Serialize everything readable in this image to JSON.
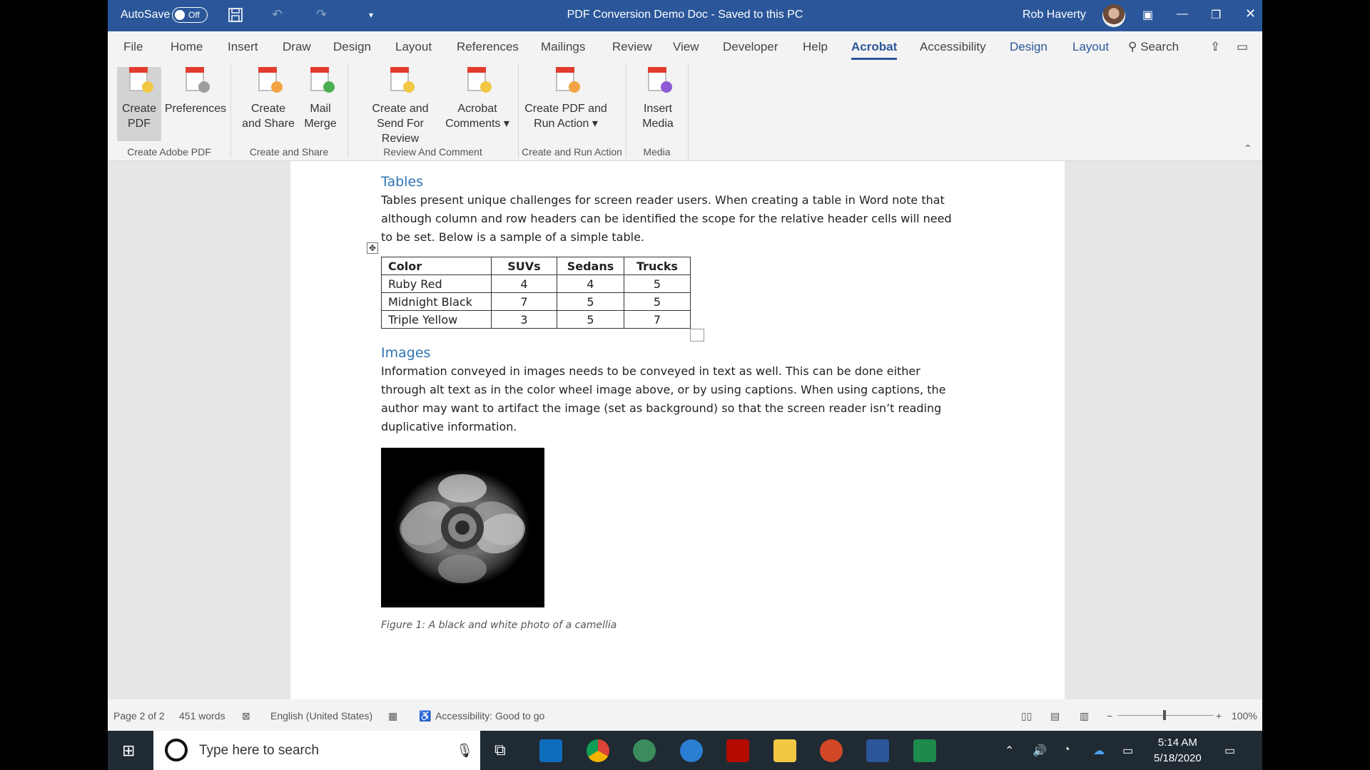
{
  "titlebar": {
    "autosave_label": "AutoSave",
    "autosave_state": "Off",
    "doc_title": "PDF Conversion Demo Doc  -  Saved to this PC",
    "user_name": "Rob Haverty"
  },
  "menu": {
    "tabs": [
      "File",
      "Home",
      "Insert",
      "Draw",
      "Design",
      "Layout",
      "References",
      "Mailings",
      "Review",
      "View",
      "Developer",
      "Help",
      "Acrobat",
      "Accessibility",
      "Design",
      "Layout"
    ],
    "active_tab": "Acrobat",
    "search_label": "Search"
  },
  "ribbon": {
    "buttons": [
      {
        "label1": "Create",
        "label2": "PDF"
      },
      {
        "label1": "Preferences",
        "label2": ""
      },
      {
        "label1": "Create",
        "label2": "and Share"
      },
      {
        "label1": "Mail",
        "label2": "Merge"
      },
      {
        "label1": "Create and",
        "label2": "Send For Review"
      },
      {
        "label1": "Acrobat",
        "label2": "Comments ▾"
      },
      {
        "label1": "Create PDF and",
        "label2": "Run Action ▾"
      },
      {
        "label1": "Insert",
        "label2": "Media"
      }
    ],
    "groups": [
      "Create Adobe PDF",
      "Create and Share",
      "Review And Comment",
      "Create and Run Action",
      "Media"
    ]
  },
  "document": {
    "tables_heading": "Tables",
    "tables_paragraph": "Tables present unique challenges for screen reader users. When creating a table in Word note that although column and row headers can be identified the scope for the relative header cells will need to be set. Below is a sample of a simple table.",
    "table": {
      "headers": [
        "Color",
        "SUVs",
        "Sedans",
        "Trucks"
      ],
      "rows": [
        [
          "Ruby Red",
          "4",
          "4",
          "5"
        ],
        [
          "Midnight Black",
          "7",
          "5",
          "5"
        ],
        [
          "Triple Yellow",
          "3",
          "5",
          "7"
        ]
      ]
    },
    "images_heading": "Images",
    "images_paragraph": "Information conveyed in images needs to be conveyed in text as well. This can be done either through alt text as in the color wheel image above, or by using captions. When using captions, the author may want to artifact the image (set as background) so that the screen reader isn’t reading duplicative information.",
    "caption": "Figure 1: A black and white photo of a camellia"
  },
  "statusbar": {
    "page": "Page 2 of 2",
    "words": "451 words",
    "language": "English (United States)",
    "accessibility": "Accessibility: Good to go",
    "zoom": "100%"
  },
  "taskbar": {
    "search_placeholder": "Type here to search",
    "time": "5:14 AM",
    "date": "5/18/2020"
  }
}
